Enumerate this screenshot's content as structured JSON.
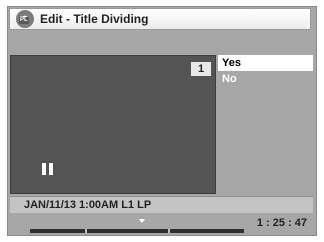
{
  "header": {
    "icon": "disc-playlist-icon",
    "icon_label": "PL",
    "title": "Edit - Title Dividing"
  },
  "video": {
    "chapter_number": "1",
    "state": "paused"
  },
  "menu": {
    "items": [
      {
        "label": "Yes",
        "selected": true
      },
      {
        "label": "No",
        "selected": false
      }
    ]
  },
  "info": {
    "status_line": "JAN/11/13 1:00AM L1   LP"
  },
  "playback": {
    "elapsed_time": "1 : 25 : 47"
  },
  "colors": {
    "screen_bg": "#a7a7a7",
    "video_bg": "#545454",
    "selected_bg": "#ffffff",
    "menu_text": "#ffffff"
  }
}
